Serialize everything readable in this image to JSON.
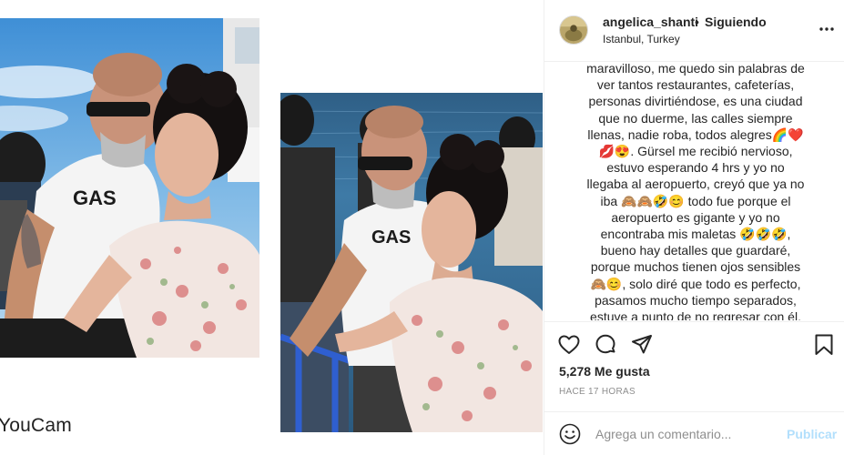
{
  "media": {
    "watermark": "YouCam"
  },
  "post": {
    "username": "angelica_shanti",
    "separator": "•",
    "follow_status": "Siguiendo",
    "location": "Istanbul, Turkey",
    "caption": "maravilloso, me quedo sin palabras de\nver tantos restaurantes, cafeterías,\npersonas divirtiéndose, es una ciudad\nque no duerme, las calles siempre\nllenas, nadie roba, todos alegres🌈❤️\n💋😍. Gürsel me recibió nervioso,\nestuvo esperando 4 hrs y yo no\nllegaba al aeropuerto, creyó que ya no\niba 🙈🙈🤣😊 todo fue porque el\naeropuerto es gigante y yo no\nencontraba mis maletas 🤣🤣🤣,\nbueno hay detalles que guardaré,\nporque muchos tienen ojos sensibles\n🙈😊, solo diré que todo es perfecto,\npasamos mucho tiempo separados,\nestuve a punto de no regresar con él.",
    "likes": "5,278 Me gusta",
    "time": "HACE 17 HORAS"
  },
  "icons": {
    "more": "more-options-icon",
    "like": "heart-icon",
    "comment": "comment-icon",
    "share": "share-icon",
    "save": "bookmark-icon",
    "emoji": "emoji-icon"
  },
  "comment": {
    "placeholder": "Agrega un comentario...",
    "publish_label": "Publicar"
  },
  "colors": {
    "text": "#262626",
    "secondary": "#8e8e8e",
    "border": "#efefef",
    "publish_disabled": "#b2dffc"
  }
}
